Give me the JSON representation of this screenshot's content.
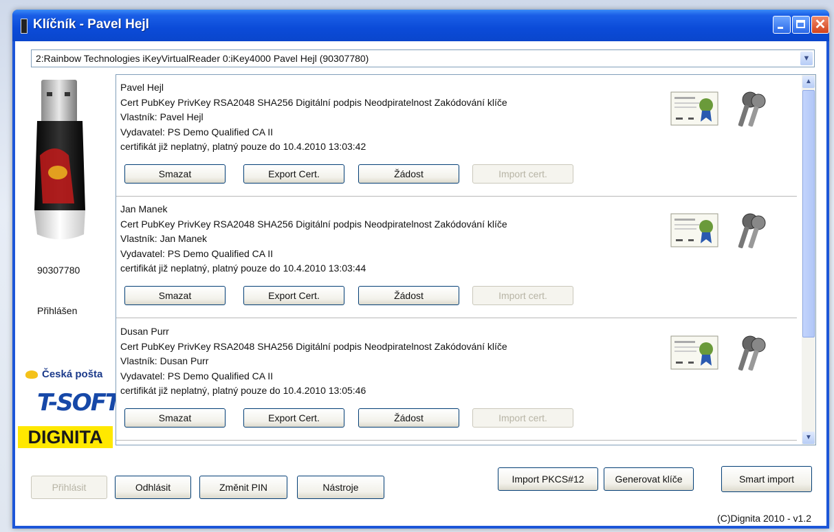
{
  "window": {
    "title": "Klíčník - Pavel Hejl"
  },
  "reader_select": {
    "value": "2:Rainbow Technologies iKeyVirtualReader 0:iKey4000 Pavel Hejl (90307780)"
  },
  "token": {
    "serial": "90307780",
    "status": "Přihlášen"
  },
  "logos": {
    "ceska_posta": "Česká pošta",
    "tsoft": "T-SOFT",
    "dignita": "DIGNITA"
  },
  "entries": [
    {
      "name": "Pavel Hejl",
      "details": "Cert PubKey PrivKey  RSA2048 SHA256 Digitální podpis Neodpiratelnost Zakódování klíče",
      "owner": "Vlastník: Pavel Hejl",
      "issuer": "Vydavatel: PS Demo Qualified CA II",
      "validity": "certifikát již neplatný, platný pouze do 10.4.2010 13:03:42"
    },
    {
      "name": "Jan Manek",
      "details": "Cert PubKey PrivKey  RSA2048 SHA256 Digitální podpis Neodpiratelnost Zakódování klíče",
      "owner": "Vlastník: Jan Manek",
      "issuer": "Vydavatel: PS Demo Qualified CA II",
      "validity": "certifikát již neplatný, platný pouze do 10.4.2010 13:03:44"
    },
    {
      "name": "Dusan Purr",
      "details": "Cert PubKey PrivKey  RSA2048 SHA256 Digitální podpis Neodpiratelnost Zakódování klíče",
      "owner": "Vlastník: Dusan Purr",
      "issuer": "Vydavatel: PS Demo Qualified CA II",
      "validity": "certifikát již neplatný, platný pouze do 10.4.2010 13:05:46"
    }
  ],
  "entry_buttons": {
    "delete": "Smazat",
    "export": "Export Cert.",
    "request": "Žádost",
    "import": "Import cert."
  },
  "bottom_buttons": {
    "login": "Přihlásit",
    "logout": "Odhlásit",
    "change_pin": "Změnit PIN",
    "tools": "Nástroje",
    "import_pkcs12": "Import PKCS#12",
    "generate_keys": "Generovat klíče",
    "smart_import": "Smart import"
  },
  "footer": {
    "copyright": "(C)Dignita 2010 - v1.2"
  },
  "icons": {
    "certificate": "certificate-icon",
    "keys": "keys-icon"
  }
}
